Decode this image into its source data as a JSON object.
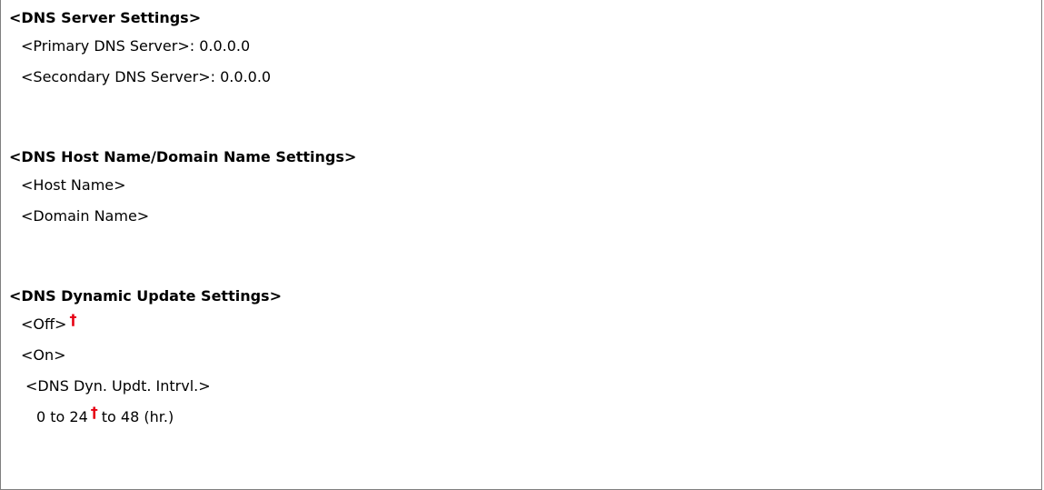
{
  "dns_server": {
    "heading": "<DNS Server Settings>",
    "primary_label": "<Primary DNS Server>",
    "primary_value": ": 0.0.0.0",
    "secondary_label": "<Secondary DNS Server>",
    "secondary_value": ": 0.0.0.0"
  },
  "dns_host": {
    "heading": "<DNS Host Name/Domain Name Settings>",
    "host_name": "<Host Name>",
    "domain_name": "<Domain Name>"
  },
  "dns_dynamic": {
    "heading": "<DNS Dynamic Update Settings>",
    "off": "<Off>",
    "on": "<On>",
    "interval_label": "<DNS Dyn. Updt. Intrvl.>",
    "range_start": "0 to 24",
    "range_end": "to 48 (hr.)"
  },
  "marks": {
    "default_marker": "†",
    "default_marker_color": "#e60012"
  }
}
